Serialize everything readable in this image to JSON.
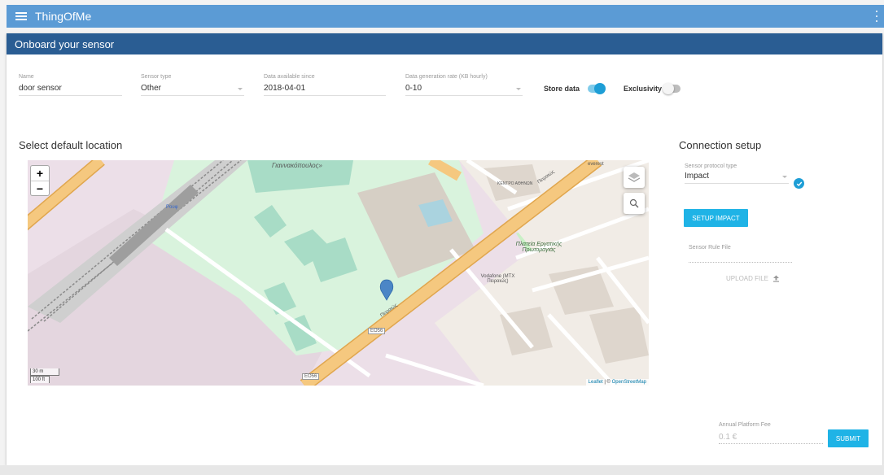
{
  "app": {
    "title": "ThingOfMe"
  },
  "header": {
    "title": "Onboard your sensor"
  },
  "form": {
    "name": {
      "label": "Name",
      "value": "door sensor"
    },
    "sensor_type": {
      "label": "Sensor type",
      "value": "Other"
    },
    "data_since": {
      "label": "Data available since",
      "value": "2018-04-01"
    },
    "generation_rate": {
      "label": "Data generation rate (KB hourly)",
      "value": "0-10"
    },
    "store_data": {
      "label": "Store data",
      "on": true
    },
    "exclusivity": {
      "label": "Exclusivity",
      "on": false
    }
  },
  "location": {
    "title": "Select default location"
  },
  "map": {
    "zoom_in": "+",
    "zoom_out": "−",
    "scale_m": "30 m",
    "scale_ft": "100 ft",
    "attribution_leaflet": "Leaflet",
    "attribution_sep": " | © ",
    "attribution_osm": "OpenStreetMap",
    "road_label_1": "EO56",
    "road_label_2": "EO56",
    "street_1": "Πειραιώς",
    "street_2": "Πειραιώς",
    "square_label": "Πλατεία Εργατικής Πρωτομαγιάς",
    "building_label": "Γιαννακόπουλος»",
    "vodafone_label": "Vodafone (ΜΤΧ Πειραιώς)",
    "kentro_label": "ΚΕΝΤΡΟ ΑΘΗΝΩΝ",
    "rouf_label": "Ρουφ",
    "everest_label": "everest"
  },
  "connection": {
    "title": "Connection setup",
    "protocol": {
      "label": "Sensor protocol type",
      "value": "Impact"
    },
    "setup_button": "SETUP IMPACT",
    "rule_file": {
      "label": "Sensor Rule File",
      "upload": "UPLOAD FILE"
    }
  },
  "fee": {
    "label": "Annual Platform Fee",
    "value": "0.1 €"
  },
  "submit": "SUBMIT",
  "colors": {
    "topbar": "#5b9bd5",
    "header": "#2a5d93",
    "accent": "#1fb3e6",
    "park": "#d9f3dd",
    "road": "#f5c87f"
  }
}
